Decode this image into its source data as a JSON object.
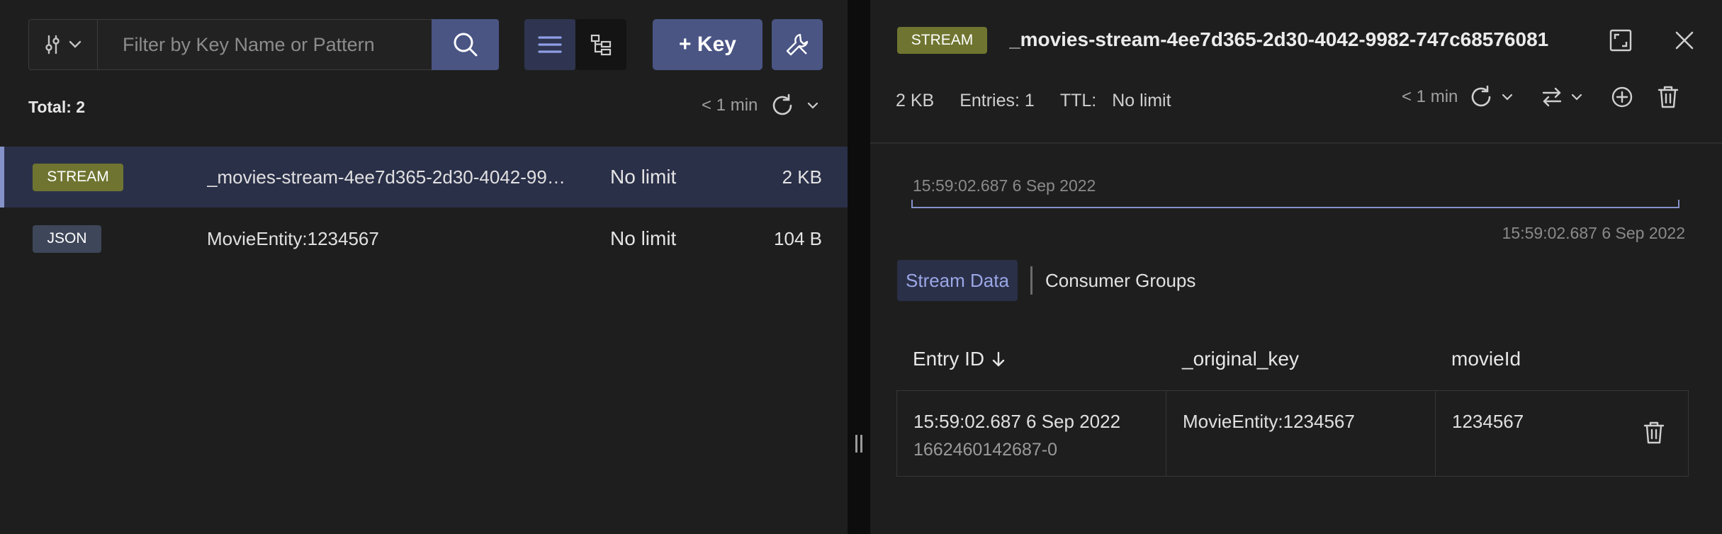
{
  "left": {
    "filter_placeholder": "Filter by Key Name or Pattern",
    "add_key_label": "+ Key",
    "total": "Total: 2",
    "refresh_time": "< 1 min",
    "keys": [
      {
        "type": "STREAM",
        "name": "_movies-stream-4ee7d365-2d30-4042-9982-747c68576081",
        "ttl": "No limit",
        "size": "2 KB",
        "selected": true
      },
      {
        "type": "JSON",
        "name": "MovieEntity:1234567",
        "ttl": "No limit",
        "size": "104 B",
        "selected": false
      }
    ]
  },
  "right": {
    "badge": "STREAM",
    "key_name": "_movies-stream-4ee7d365-2d30-4042-9982-747c68576081",
    "size": "2 KB",
    "entries": "Entries: 1",
    "ttl_label": "TTL:",
    "ttl_value": "No limit",
    "refresh_time": "< 1 min",
    "timeline_start": "15:59:02.687 6 Sep 2022",
    "timeline_end": "15:59:02.687 6 Sep 2022",
    "tabs": [
      "Stream Data",
      "Consumer Groups"
    ],
    "columns": [
      "Entry ID",
      "_original_key",
      "movieId"
    ],
    "rows": [
      {
        "entry_time": "15:59:02.687 6 Sep 2022",
        "entry_id": "1662460142687-0",
        "original_key": "MovieEntity:1234567",
        "movie_id": "1234567"
      }
    ]
  },
  "colors": {
    "accent": "#4a5584",
    "stream_badge": "#6f7530",
    "json_badge": "#3e4759",
    "selected_row": "#2b3049",
    "active_tab_text": "#9aa8e6"
  }
}
